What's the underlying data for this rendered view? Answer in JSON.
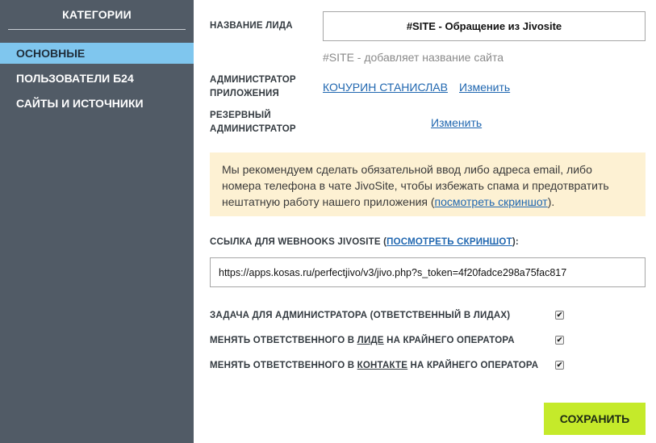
{
  "sidebar": {
    "title": "КАТЕГОРИИ",
    "items": [
      {
        "label": "ОСНОВНЫЕ",
        "active": true
      },
      {
        "label": "ПОЛЬЗОВАТЕЛИ Б24",
        "active": false
      },
      {
        "label": "САЙТЫ И ИСТОЧНИКИ",
        "active": false
      }
    ]
  },
  "form": {
    "lead_name_label": "НАЗВАНИЕ ЛИДА",
    "lead_name_value": "#SITE - Обращение из Jivosite",
    "lead_name_hint": "#SITE - добавляет название сайта",
    "admin_label_1": "АДМИНИСТРАТОР",
    "admin_label_2": "ПРИЛОЖЕНИЯ",
    "admin_name": "КОЧУРИН СТАНИСЛАВ",
    "admin_change": "Изменить",
    "reserve_label_1": "РЕЗЕРВНЫЙ",
    "reserve_label_2": "АДМИНИСТРАТОР",
    "reserve_change": "Изменить",
    "notice_text_1": "Мы рекомендуем сделать обязательной ввод либо адреса email, либо",
    "notice_text_2": "номера телефона в чате JivoSite, чтобы избежать спама и предотвратить",
    "notice_text_3_pre": "нештатную работу нашего приложения (",
    "notice_link": "посмотреть скриншот",
    "notice_text_3_post": ").",
    "webhook_label_pre": "ССЫЛКА ДЛЯ WEBHOOKS JIVOSITE (",
    "webhook_label_link": "ПОСМОТРЕТЬ СКРИНШОТ",
    "webhook_label_post": "):",
    "webhook_url": "https://apps.kosas.ru/perfectjivo/v3/jivo.php?s_token=4f20fadce298a75fac817",
    "checks": [
      {
        "pre": "ЗАДАЧА ДЛЯ АДМИНИСТРАТОРА (ОТВЕТСТВЕННЫЙ В ЛИДАХ)",
        "u": "",
        "post": "",
        "checked": true
      },
      {
        "pre": "МЕНЯТЬ ОТВЕТСТВЕННОГО В ",
        "u": "ЛИДЕ",
        "post": " НА КРАЙНЕГО ОПЕРАТОРА",
        "checked": true
      },
      {
        "pre": "МЕНЯТЬ ОТВЕТСТВЕННОГО В ",
        "u": "КОНТАКТЕ",
        "post": " НА КРАЙНЕГО ОПЕРАТОРА",
        "checked": true
      }
    ],
    "checkmark": "✔",
    "save_label": "СОХРАНИТЬ"
  },
  "colors": {
    "sidebar_bg": "#515b66",
    "active_item": "#7fc6ee",
    "notice_bg": "#fdf1d3",
    "link": "#2067b0",
    "save_button": "#c5ea2a"
  }
}
